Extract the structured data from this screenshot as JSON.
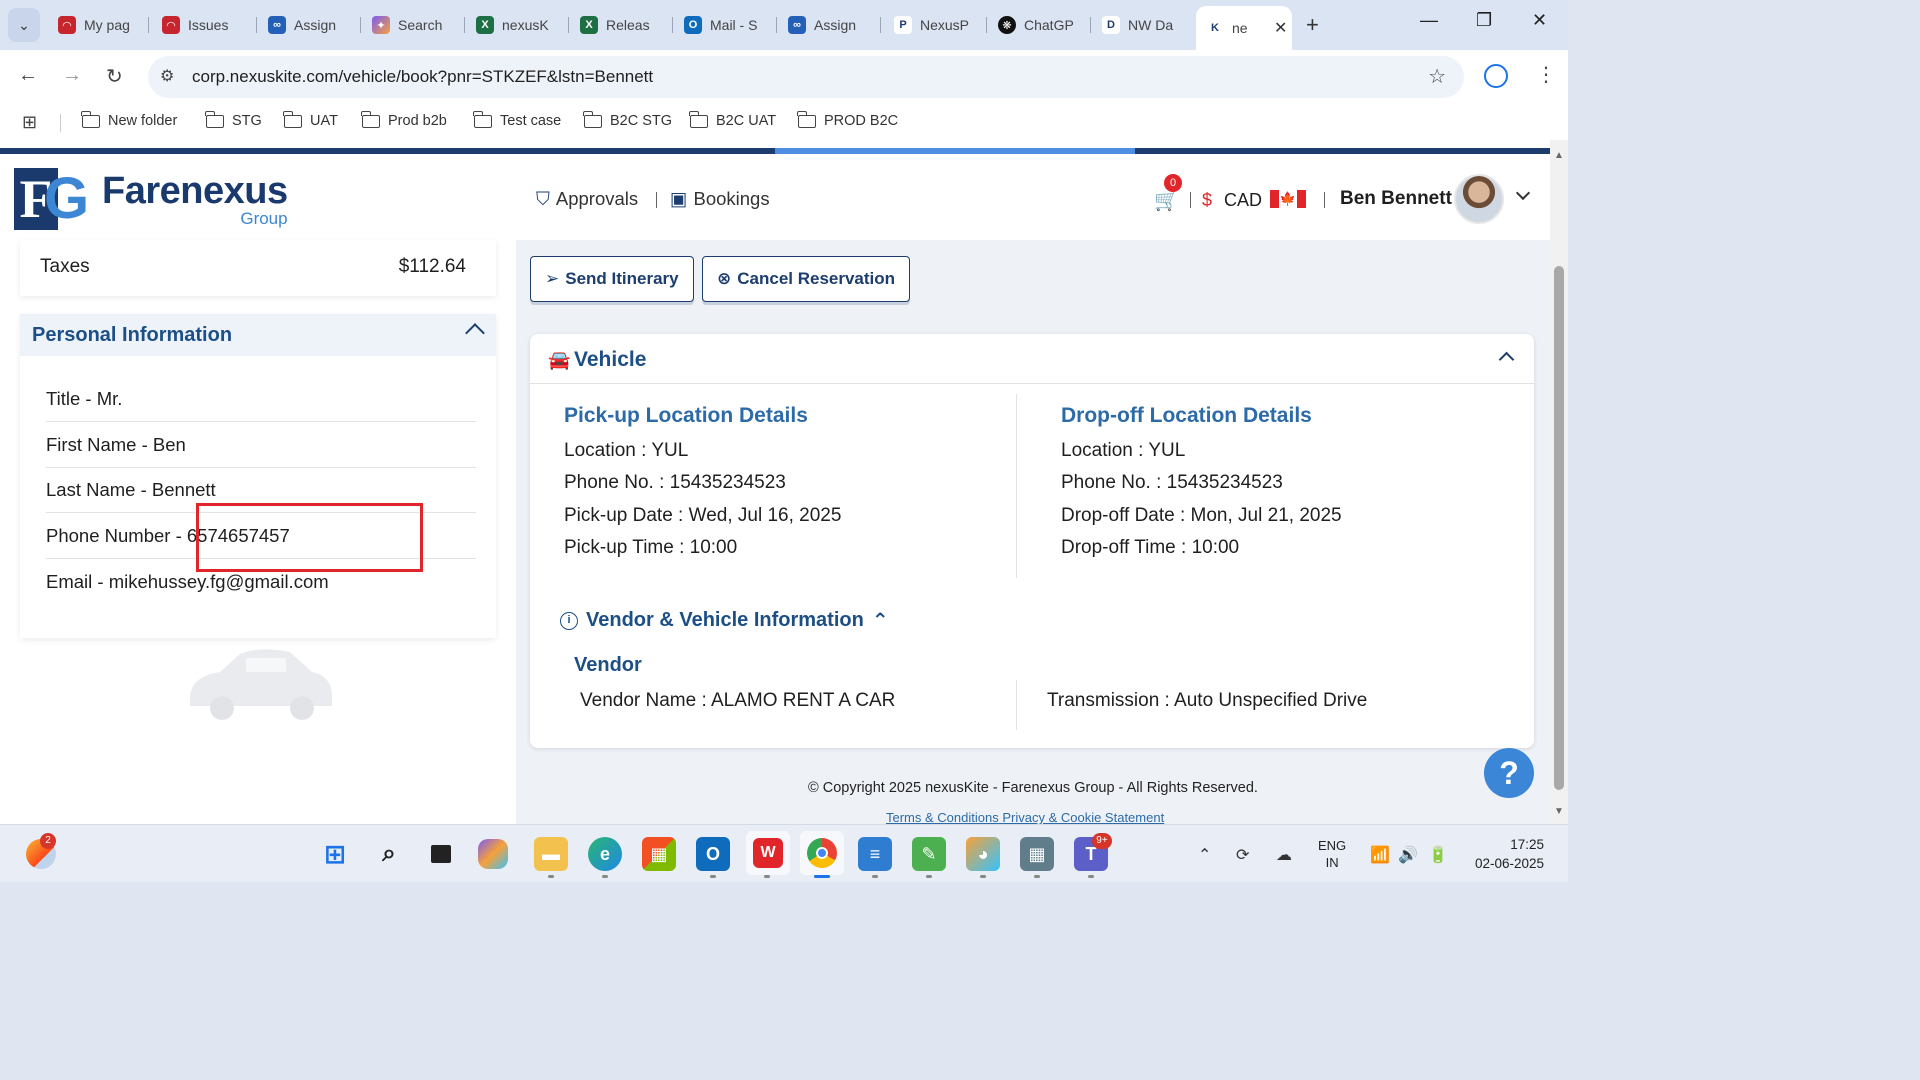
{
  "browser": {
    "tabs": [
      {
        "title": "My pag",
        "favicon": "jira-icon",
        "color": "#c7252d"
      },
      {
        "title": "Issues",
        "favicon": "jira-icon",
        "color": "#c7252d"
      },
      {
        "title": "Assign",
        "favicon": "azure-devops-icon",
        "color": "#2460b7"
      },
      {
        "title": "Search",
        "favicon": "copilot-icon",
        "color": "#7a5af5"
      },
      {
        "title": "nexusK",
        "favicon": "excel-icon",
        "color": "#1d7044"
      },
      {
        "title": "Releas",
        "favicon": "excel-icon",
        "color": "#1d7044"
      },
      {
        "title": "Mail - S",
        "favicon": "outlook-icon",
        "color": "#0f6cbd"
      },
      {
        "title": "Assign",
        "favicon": "azure-devops-icon",
        "color": "#2460b7"
      },
      {
        "title": "NexusP",
        "favicon": "p-icon",
        "color": "#1c3d6e"
      },
      {
        "title": "ChatGP",
        "favicon": "chatgpt-icon",
        "color": "#111111"
      },
      {
        "title": "NW Da",
        "favicon": "d-icon",
        "color": "#1c3d6e"
      },
      {
        "title": "ne",
        "favicon": "k-icon",
        "color": "#1c3d6e"
      }
    ],
    "url": "corp.nexuskite.com/vehicle/book?pnr=STKZEF&lstn=Bennett",
    "bookmarks": [
      "New folder",
      "STG",
      "UAT",
      "Prod b2b",
      "Test case",
      "B2C STG",
      "B2C UAT",
      "PROD B2C"
    ]
  },
  "brand": {
    "name": "Farenexus",
    "sub": "Group",
    "mark": "FG",
    "primary": "#1a3a6e",
    "accent": "#3c86d4"
  },
  "left": {
    "taxes_label": "Taxes",
    "taxes_value": "$112.64",
    "personal_title": "Personal Information",
    "rows": [
      "Title - Mr.",
      "First Name - Ben",
      "Last Name - Bennett",
      "Phone Number - 6574657457",
      "Email - mikehussey.fg@gmail.com"
    ]
  },
  "header": {
    "approvals": "Approvals",
    "bookings": "Bookings",
    "cart_count": "0",
    "currency_symbol": "$",
    "currency": "CAD",
    "user_name": "Ben Bennett"
  },
  "actions": {
    "send_itinerary": "Send Itinerary",
    "cancel_reservation": "Cancel Reservation"
  },
  "vehicle": {
    "title": "Vehicle",
    "pickup": {
      "title": "Pick-up Location Details",
      "location": "Location : YUL",
      "phone": "Phone No. : 15435234523",
      "date": "Pick-up Date : Wed, Jul 16, 2025",
      "time": "Pick-up Time : 10:00"
    },
    "dropoff": {
      "title": "Drop-off Location Details",
      "location": "Location : YUL",
      "phone": "Phone No. : 15435234523",
      "date": "Drop-off Date : Mon, Jul 21, 2025",
      "time": "Drop-off Time : 10:00"
    },
    "vvi_title": "Vendor & Vehicle Information",
    "vendor_title": "Vendor",
    "vendor_name": "Vendor Name : ALAMO RENT A CAR",
    "transmission": "Transmission : Auto Unspecified Drive"
  },
  "footer": {
    "copyright": "© Copyright 2025 nexusKite - Farenexus Group - All Rights Reserved.",
    "terms": "Terms & Conditions",
    "privacy": "Privacy & Cookie Statement",
    "help": "?"
  },
  "taskbar": {
    "weather_badge": "2",
    "teams_badge": "9+",
    "lang1": "ENG",
    "lang2": "IN",
    "time": "17:25",
    "date": "02-06-2025"
  }
}
